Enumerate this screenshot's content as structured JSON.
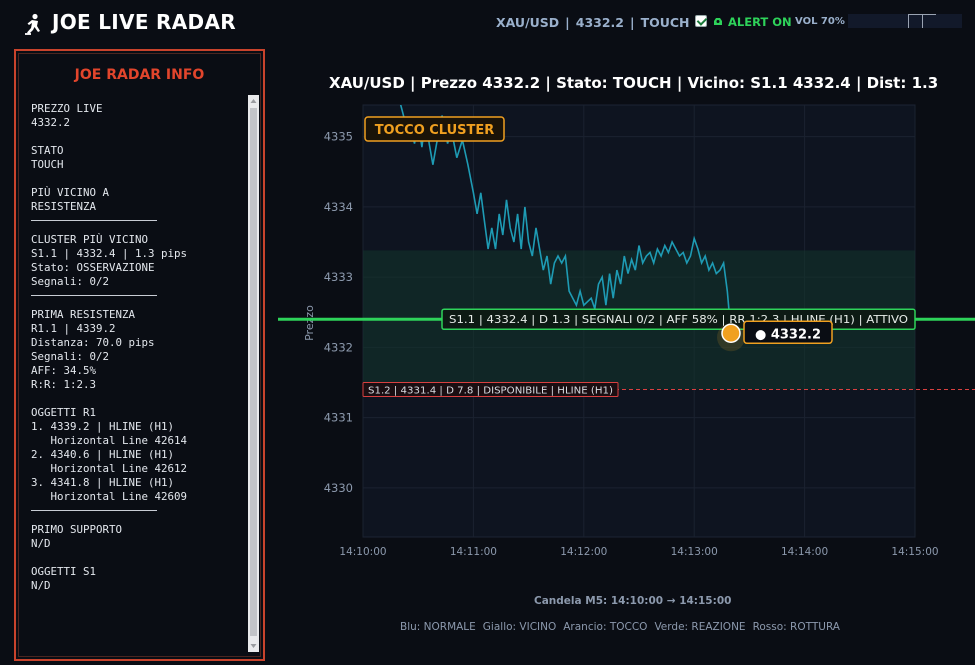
{
  "header": {
    "app_title": "JOE LIVE RADAR",
    "symbol": "XAU/USD",
    "price": "4332.2",
    "state": "TOUCH",
    "alert_label": "ALERT ON",
    "alert_checked": true,
    "vol_label": "VOL 70%",
    "vol_level": 0.7
  },
  "info_panel": {
    "title": "JOE RADAR INFO",
    "sections": [
      {
        "lines": [
          "PREZZO LIVE",
          "4332.2"
        ],
        "rule": false
      },
      {
        "lines": [
          "STATO",
          "TOUCH"
        ],
        "rule": false
      },
      {
        "lines": [
          "PIÙ VICINO A",
          "RESISTENZA"
        ],
        "rule": true
      },
      {
        "lines": [
          "CLUSTER PIÙ VICINO",
          "S1.1 | 4332.4 | 1.3 pips",
          "Stato: OSSERVAZIONE",
          "Segnali: 0/2"
        ],
        "rule": true
      },
      {
        "lines": [
          "PRIMA RESISTENZA",
          "R1.1 | 4339.2",
          "Distanza: 70.0 pips",
          "Segnali: 0/2",
          "AFF: 34.5%",
          "R:R: 1:2.3"
        ],
        "rule": false
      },
      {
        "lines": [
          "OGGETTI R1",
          "1. 4339.2 | HLINE (H1)",
          "   Horizontal Line 42614",
          "2. 4340.6 | HLINE (H1)",
          "   Horizontal Line 42612",
          "3. 4341.8 | HLINE (H1)",
          "   Horizontal Line 42609"
        ],
        "rule": true
      },
      {
        "lines": [
          "PRIMO SUPPORTO",
          "N/D"
        ],
        "rule": false
      },
      {
        "lines": [
          "OGGETTI S1",
          "N/D"
        ],
        "rule": false
      }
    ]
  },
  "chart_title": "XAU/USD | Prezzo 4332.2 | Stato: TOUCH | Vicino: S1.1 4332.4 | Dist: 1.3",
  "candle_label": "Candela M5: 14:10:00 → 14:15:00",
  "legend": [
    "Blu: NORMALE",
    "Giallo: VICINO",
    "Arancio: TOCCO",
    "Verde: REAZIONE",
    "Rosso: ROTTURA"
  ],
  "colors": {
    "price_line": "#1e9bb4",
    "s11_line": "#2ed35a",
    "s12_line": "#d94040",
    "touch_badge": "#f0a020",
    "zone": "#12352c"
  },
  "chart_data": {
    "type": "line",
    "ylabel": "Prezzo",
    "ylim": [
      4329.3,
      4335.45
    ],
    "xlim": [
      "14:10:00",
      "14:15:00"
    ],
    "yticks": [
      4330,
      4331,
      4332,
      4333,
      4334,
      4335
    ],
    "xticks": [
      "14:10:00",
      "14:11:00",
      "14:12:00",
      "14:13:00",
      "14:14:00",
      "14:15:00"
    ],
    "grid": true,
    "zone": [
      4331.4,
      4333.38
    ],
    "badge_label": "TOCCO CLUSTER",
    "levels": [
      {
        "price": 4332.4,
        "label": "S1.1 | 4332.4 | D 1.3 | SEGNALI 0/2 | AFF 58% | RR 1:2.3 | HLINE (H1) | ATTIVO"
      },
      {
        "price": 4331.4,
        "label": "S1.2 | 4331.4 | D 7.8 | DISPONIBILE | HLINE (H1)"
      }
    ],
    "current_price": {
      "time": "14:13:20",
      "value": 4332.2,
      "label": "● 4332.2"
    },
    "series": [
      {
        "x": [
          "14:10:20",
          "14:10:22",
          "14:10:24",
          "14:10:26",
          "14:10:28",
          "14:10:30",
          "14:10:32",
          "14:10:34",
          "14:10:36",
          "14:10:38",
          "14:10:40",
          "14:10:43",
          "14:10:46",
          "14:10:48",
          "14:10:51",
          "14:10:54",
          "14:10:57",
          "14:11:00",
          "14:11:02",
          "14:11:04",
          "14:11:06",
          "14:11:08",
          "14:11:10",
          "14:11:12",
          "14:11:14",
          "14:11:16",
          "14:11:18",
          "14:11:20",
          "14:11:22",
          "14:11:24",
          "14:11:26",
          "14:11:28",
          "14:11:30",
          "14:11:32",
          "14:11:34",
          "14:11:36",
          "14:11:38",
          "14:11:40",
          "14:11:42",
          "14:11:44",
          "14:11:46",
          "14:11:48",
          "14:11:50",
          "14:11:52",
          "14:11:54",
          "14:11:56",
          "14:11:58",
          "14:12:00",
          "14:12:02",
          "14:12:04",
          "14:12:06",
          "14:12:08",
          "14:12:10",
          "14:12:12",
          "14:12:14",
          "14:12:16",
          "14:12:18",
          "14:12:20",
          "14:12:22",
          "14:12:24",
          "14:12:26",
          "14:12:28",
          "14:12:30",
          "14:12:32",
          "14:12:34",
          "14:12:36",
          "14:12:38",
          "14:12:40",
          "14:12:42",
          "14:12:44",
          "14:12:46",
          "14:12:48",
          "14:12:50",
          "14:12:52",
          "14:12:54",
          "14:12:56",
          "14:12:58",
          "14:13:00",
          "14:13:02",
          "14:13:04",
          "14:13:06",
          "14:13:08",
          "14:13:10",
          "14:13:12",
          "14:13:14",
          "14:13:16",
          "14:13:18",
          "14:13:20"
        ],
        "y": [
          4335.5,
          4335.3,
          4335.0,
          4335.15,
          4334.9,
          4335.2,
          4334.85,
          4335.25,
          4334.9,
          4334.6,
          4334.9,
          4335.3,
          4334.9,
          4335.1,
          4334.7,
          4334.95,
          4334.6,
          4334.2,
          4333.9,
          4334.2,
          4333.8,
          4333.4,
          4333.7,
          4333.4,
          4333.9,
          4333.6,
          4334.1,
          4333.7,
          4333.5,
          4333.9,
          4333.4,
          4334.0,
          4333.5,
          4333.3,
          4333.7,
          4333.4,
          4333.1,
          4333.3,
          4332.9,
          4333.2,
          4333.3,
          4333.2,
          4333.3,
          4332.8,
          4332.7,
          4332.6,
          4332.8,
          4332.6,
          4332.65,
          4332.7,
          4332.55,
          4332.9,
          4333.0,
          4332.6,
          4333.05,
          4332.7,
          4333.1,
          4332.9,
          4333.3,
          4333.05,
          4333.25,
          4333.1,
          4333.45,
          4333.2,
          4333.3,
          4333.35,
          4333.2,
          4333.4,
          4333.3,
          4333.45,
          4333.35,
          4333.5,
          4333.4,
          4333.3,
          4333.35,
          4333.2,
          4333.3,
          4333.55,
          4333.4,
          4333.2,
          4333.3,
          4333.1,
          4333.2,
          4333.05,
          4333.1,
          4333.2,
          4332.8,
          4332.2
        ]
      }
    ]
  }
}
